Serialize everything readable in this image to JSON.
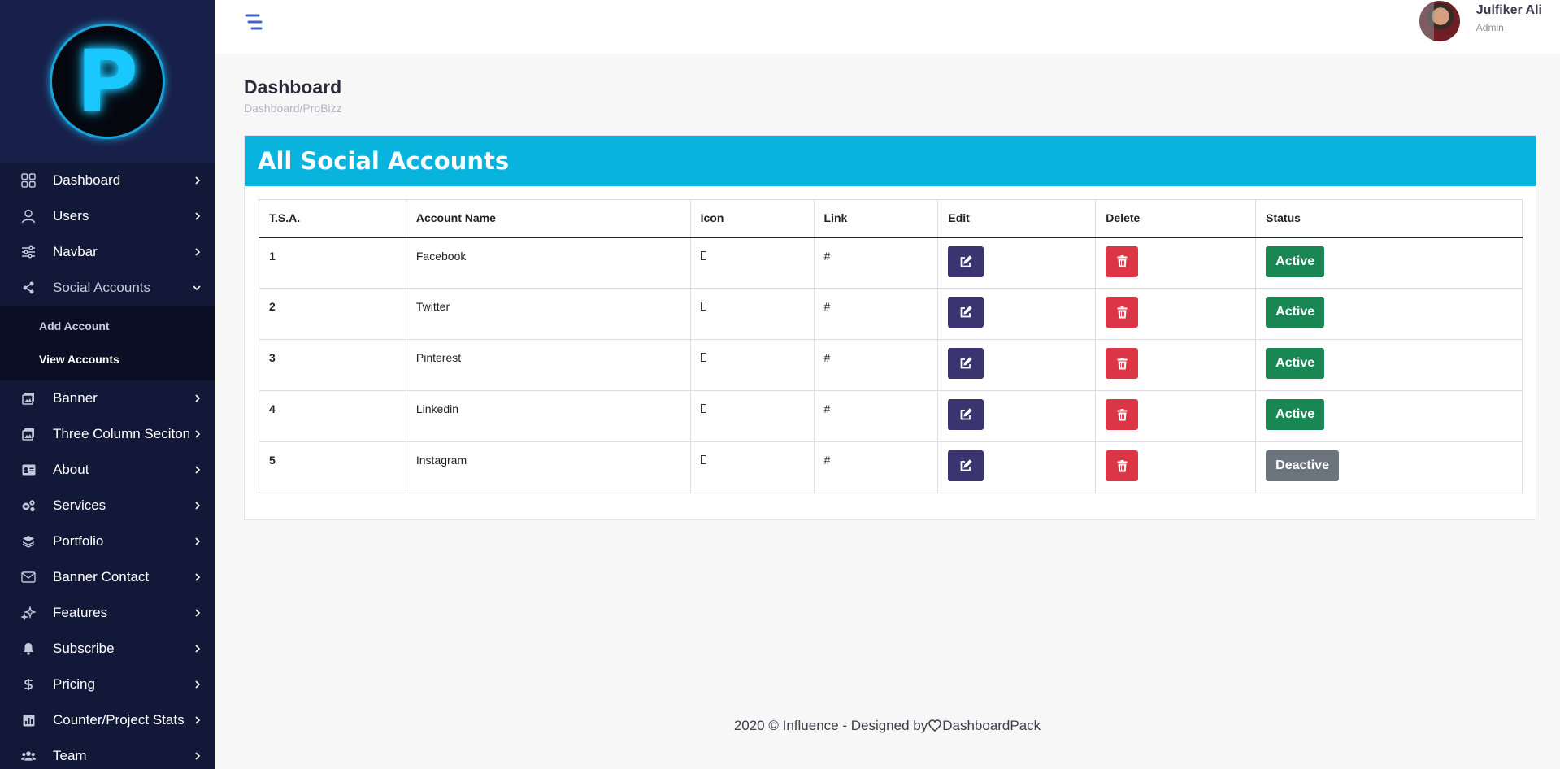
{
  "sidebar": {
    "logo_letter": "P",
    "items": [
      {
        "label": "Dashboard",
        "icon": "grid-icon"
      },
      {
        "label": "Users",
        "icon": "user-icon"
      },
      {
        "label": "Navbar",
        "icon": "sliders-icon"
      },
      {
        "label": "Social Accounts",
        "icon": "share-icon"
      },
      {
        "label": "Banner",
        "icon": "images-icon"
      },
      {
        "label": "Three Column Seciton",
        "icon": "images-icon"
      },
      {
        "label": "About",
        "icon": "id-card-icon"
      },
      {
        "label": "Services",
        "icon": "cogs-icon"
      },
      {
        "label": "Portfolio",
        "icon": "layers-icon"
      },
      {
        "label": "Banner Contact",
        "icon": "envelope-icon"
      },
      {
        "label": "Features",
        "icon": "sparkles-icon"
      },
      {
        "label": "Subscribe",
        "icon": "bell-icon"
      },
      {
        "label": "Pricing",
        "icon": "dollar-icon"
      },
      {
        "label": "Counter/Project Stats",
        "icon": "chart-icon"
      },
      {
        "label": "Team",
        "icon": "users-icon"
      }
    ],
    "social_submenu": [
      {
        "label": "Add Account"
      },
      {
        "label": "View Accounts"
      }
    ]
  },
  "topbar": {
    "user_name": "Julfiker Ali",
    "user_role": "Admin"
  },
  "page": {
    "title": "Dashboard",
    "breadcrumb": "Dashboard/ProBizz"
  },
  "card": {
    "title": "All Social Accounts",
    "columns": [
      "T.S.A.",
      "Account Name",
      "Icon",
      "Link",
      "Edit",
      "Delete",
      "Status"
    ],
    "rows": [
      {
        "num": "1",
        "name": "Facebook",
        "link": "#",
        "status": "Active"
      },
      {
        "num": "2",
        "name": "Twitter",
        "link": "#",
        "status": "Active"
      },
      {
        "num": "3",
        "name": "Pinterest",
        "link": "#",
        "status": "Active"
      },
      {
        "num": "4",
        "name": "Linkedin",
        "link": "#",
        "status": "Active"
      },
      {
        "num": "5",
        "name": "Instagram",
        "link": "#",
        "status": "Deactive"
      }
    ]
  },
  "footer": {
    "before": "2020 © Influence - Designed by",
    "after": "DashboardPack"
  },
  "colors": {
    "sidebar_bg": "#111838",
    "card_header": "#08b4dd",
    "edit_button": "#3a3471",
    "delete_button": "#dc3545",
    "active_status": "#198754",
    "deactive_status": "#6c757d"
  }
}
